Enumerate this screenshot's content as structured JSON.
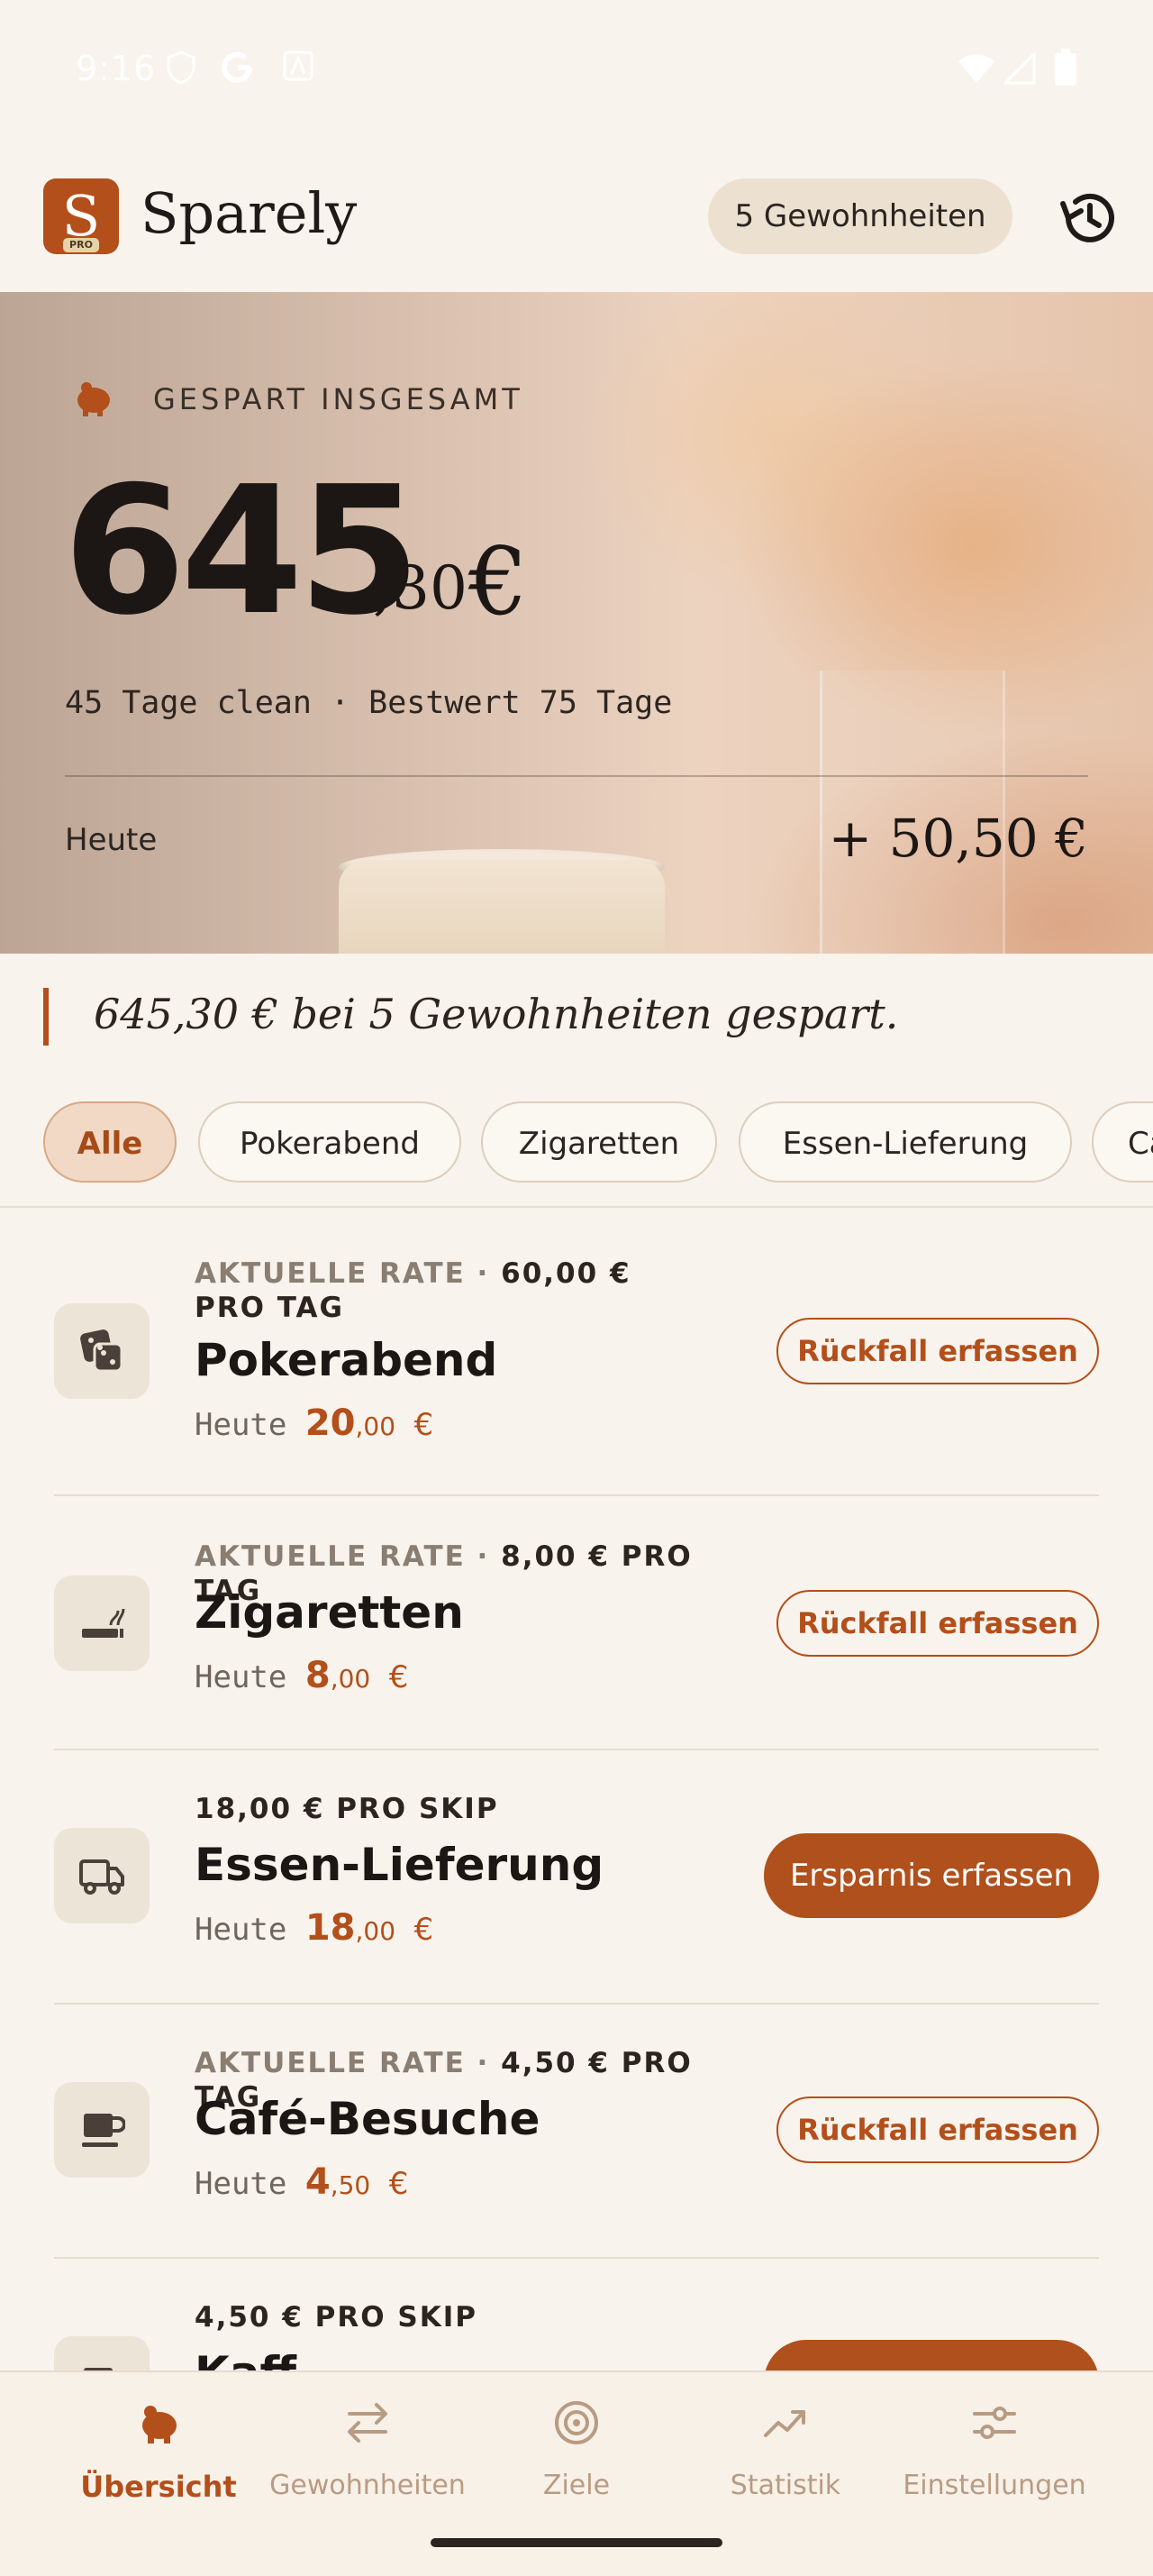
{
  "status_bar": {
    "time": "9:16"
  },
  "header": {
    "brand": "Sparely",
    "logo_badge": "PRO",
    "habits_pill": "5 Gewohnheiten",
    "history_icon": "history-icon"
  },
  "hero": {
    "label": "GESPART INSGESAMT",
    "total_whole": "645",
    "total_decimals": ",30",
    "currency": "€",
    "streak": "45 Tage clean · Bestwert 75 Tage",
    "today_label": "Heute",
    "today_value": "+ 50,50 €"
  },
  "summary": "645,30 € bei 5 Gewohnheiten gespart.",
  "filters": [
    "Alle",
    "Pokerabend",
    "Zigaretten",
    "Essen-Lieferung",
    "Ca"
  ],
  "habits": [
    {
      "meta_prefix": "AKTUELLE RATE · ",
      "meta_value": "60,00 € PRO TAG",
      "name": "Pokerabend",
      "today_label": "Heute",
      "amount": "20",
      "cents": ",00",
      "currency": "€",
      "action": "Rückfall erfassen",
      "icon": "dice-icon"
    },
    {
      "meta_prefix": "AKTUELLE RATE · ",
      "meta_value": "8,00 € PRO TAG",
      "name": "Zigaretten",
      "today_label": "Heute",
      "amount": "8",
      "cents": ",00",
      "currency": "€",
      "action": "Rückfall erfassen",
      "icon": "cigarette-icon"
    },
    {
      "meta_prefix": "",
      "meta_value": "18,00 € PRO SKIP",
      "name": "Essen-Lieferung",
      "today_label": "Heute",
      "amount": "18",
      "cents": ",00",
      "currency": "€",
      "action": "Ersparnis erfassen",
      "icon": "truck-icon"
    },
    {
      "meta_prefix": "AKTUELLE RATE · ",
      "meta_value": "4,50 € PRO TAG",
      "name": "Café-Besuche",
      "today_label": "Heute",
      "amount": "4",
      "cents": ",50",
      "currency": "€",
      "action": "Rückfall erfassen",
      "icon": "coffee-cup-icon"
    },
    {
      "meta_prefix": "",
      "meta_value": "4,50 € PRO SKIP",
      "name": "Kaff",
      "icon": "cup-icon"
    }
  ],
  "nav": [
    {
      "label": "Übersicht",
      "icon": "piggy-bank-icon",
      "active": true
    },
    {
      "label": "Gewohnheiten",
      "icon": "swap-arrows-icon"
    },
    {
      "label": "Ziele",
      "icon": "target-icon"
    },
    {
      "label": "Statistik",
      "icon": "trending-up-icon"
    },
    {
      "label": "Einstellungen",
      "icon": "sliders-icon"
    }
  ],
  "colors": {
    "accent": "#b34f1a",
    "background": "#f8f3ec",
    "chip_active_bg": "#f1d9c6"
  }
}
